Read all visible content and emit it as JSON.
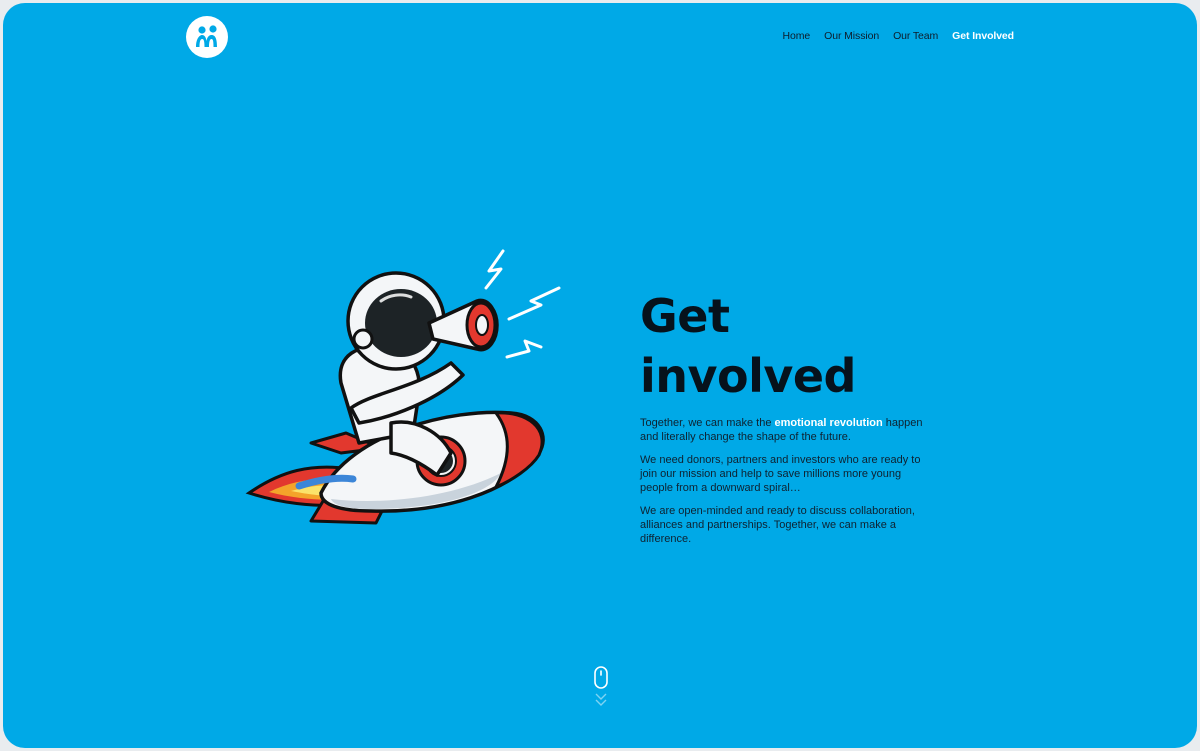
{
  "brand": {
    "logo_icon": "people-logo-icon",
    "accent_color": "#00a9e7"
  },
  "nav": {
    "items": [
      {
        "label": "Home",
        "active": false
      },
      {
        "label": "Our Mission",
        "active": false
      },
      {
        "label": "Our Team",
        "active": false
      },
      {
        "label": "Get Involved",
        "active": true
      }
    ]
  },
  "hero": {
    "illustration_icon": "astronaut-rocket-megaphone-icon",
    "heading": "Get involved",
    "paragraph1": {
      "before": "Together, we can make the ",
      "highlight": "emotional revolution",
      "after": " happen and literally change the shape of the future."
    },
    "paragraph2": "We need donors, partners and investors who are ready to join our mission and help to save millions more young people from a downward spiral…",
    "paragraph3": "We are open-minded and ready to discuss collaboration, alliances and partnerships. Together, we can make a difference."
  },
  "scroll_indicator": {
    "icon": "mouse-scroll-icon"
  }
}
